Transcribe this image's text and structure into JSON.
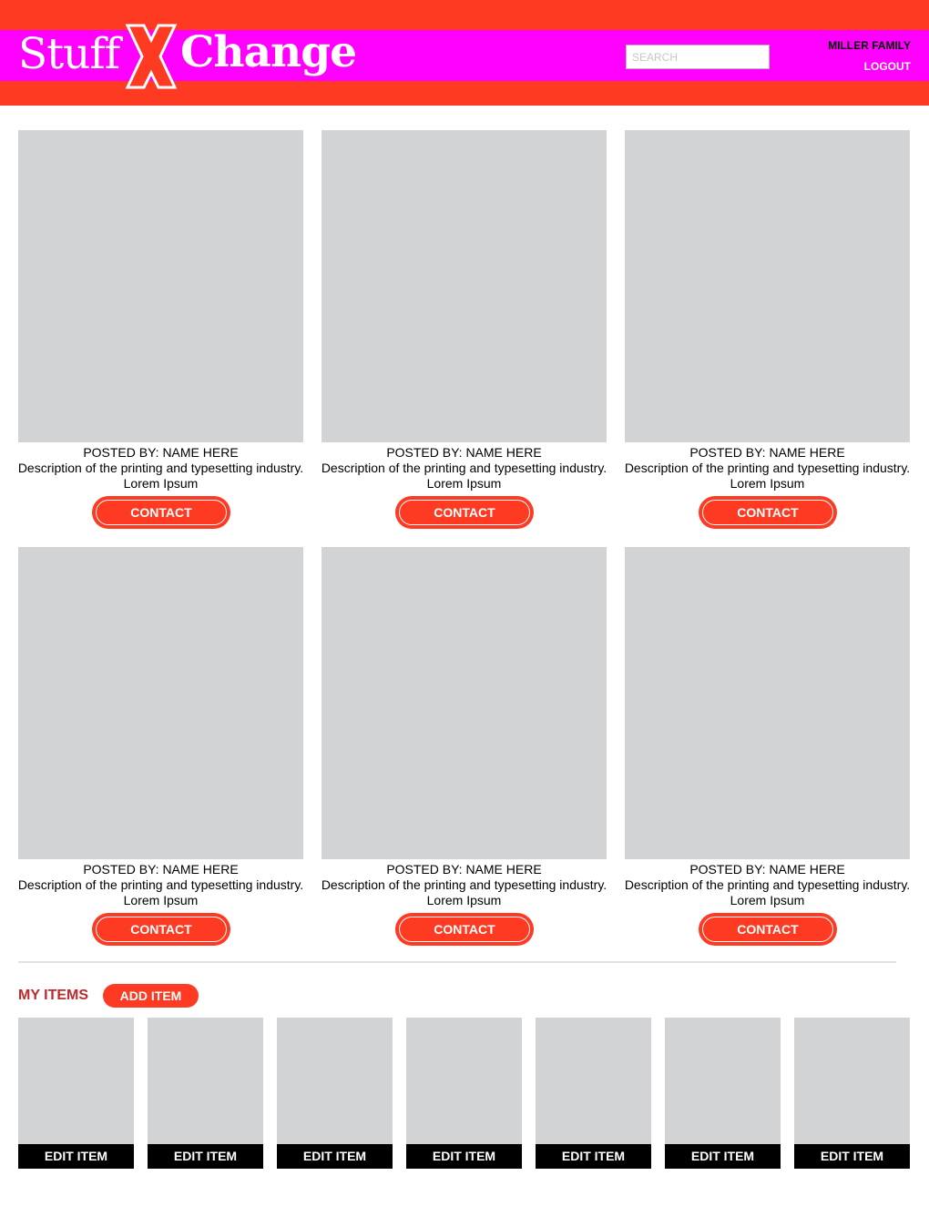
{
  "header": {
    "logo_left": "Stuff",
    "logo_right": "Change",
    "search_placeholder": "SEARCH",
    "user_name": "MILLER FAMILY",
    "logout_label": "LOGOUT"
  },
  "listings": [
    {
      "posted_by": "POSTED BY: NAME HERE",
      "description": "Description of the printing and typesetting industry.",
      "subtitle": "Lorem Ipsum",
      "button_label": "CONTACT"
    },
    {
      "posted_by": "POSTED BY: NAME HERE",
      "description": "Description of the printing and typesetting industry.",
      "subtitle": "Lorem Ipsum",
      "button_label": "CONTACT"
    },
    {
      "posted_by": "POSTED BY: NAME HERE",
      "description": "Description of the printing and typesetting industry.",
      "subtitle": "Lorem Ipsum",
      "button_label": "CONTACT"
    },
    {
      "posted_by": "POSTED BY: NAME HERE",
      "description": "Description of the printing and typesetting industry.",
      "subtitle": "Lorem Ipsum",
      "button_label": "CONTACT"
    },
    {
      "posted_by": "POSTED BY: NAME HERE",
      "description": "Description of the printing and typesetting industry.",
      "subtitle": "Lorem Ipsum",
      "button_label": "CONTACT"
    },
    {
      "posted_by": "POSTED BY: NAME HERE",
      "description": "Description of the printing and typesetting industry.",
      "subtitle": "Lorem Ipsum",
      "button_label": "CONTACT"
    }
  ],
  "my_items": {
    "title": "MY ITEMS",
    "add_label": "ADD ITEM",
    "items": [
      {
        "edit_label": "EDIT ITEM"
      },
      {
        "edit_label": "EDIT ITEM"
      },
      {
        "edit_label": "EDIT ITEM"
      },
      {
        "edit_label": "EDIT ITEM"
      },
      {
        "edit_label": "EDIT ITEM"
      },
      {
        "edit_label": "EDIT ITEM"
      },
      {
        "edit_label": "EDIT ITEM"
      }
    ]
  },
  "colors": {
    "header_red": "#ff3a22",
    "header_magenta": "#ff00ff",
    "placeholder_gray": "#d1d3d4",
    "accent_red": "#ff3a22",
    "section_title": "#c1272d",
    "edit_bar": "#000000"
  }
}
